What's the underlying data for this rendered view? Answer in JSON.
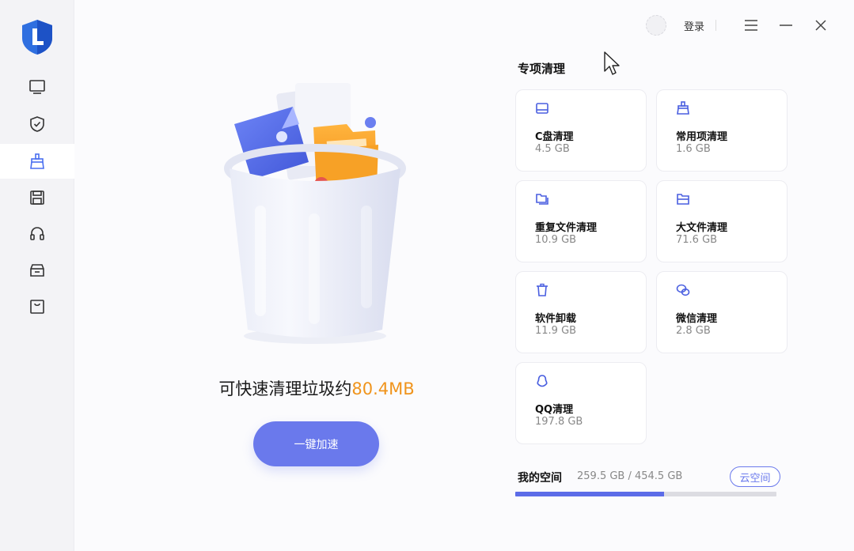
{
  "sidebar": {
    "items": [
      {
        "id": "monitor",
        "icon": "monitor-icon"
      },
      {
        "id": "shield",
        "icon": "shield-check-icon"
      },
      {
        "id": "clean",
        "icon": "broom-icon",
        "active": true
      },
      {
        "id": "disk",
        "icon": "floppy-disk-icon"
      },
      {
        "id": "support",
        "icon": "headset-icon"
      },
      {
        "id": "box",
        "icon": "archive-box-icon"
      },
      {
        "id": "bag",
        "icon": "shopping-bag-icon"
      }
    ]
  },
  "titlebar": {
    "login_label": "登录"
  },
  "center": {
    "headline_prefix": "可快速清理垃圾约",
    "headline_amount": "80.4MB",
    "button_label": "一键加速"
  },
  "panel": {
    "title": "专项清理",
    "cards": [
      {
        "name": "C盘清理",
        "size": "4.5 GB",
        "icon": "drive-icon"
      },
      {
        "name": "常用项清理",
        "size": "1.6 GB",
        "icon": "broom-icon"
      },
      {
        "name": "重复文件清理",
        "size": "10.9 GB",
        "icon": "duplicate-folder-icon"
      },
      {
        "name": "大文件清理",
        "size": "71.6 GB",
        "icon": "large-file-icon"
      },
      {
        "name": "软件卸载",
        "size": "11.9 GB",
        "icon": "trash-icon"
      },
      {
        "name": "微信清理",
        "size": "2.8 GB",
        "icon": "wechat-icon"
      },
      {
        "name": "QQ清理",
        "size": "197.8 GB",
        "icon": "qq-icon"
      }
    ]
  },
  "space": {
    "label": "我的空间",
    "value": "259.5 GB / 454.5 GB",
    "used_fraction": 0.571,
    "cloud_button": "云空间"
  },
  "colors": {
    "accent": "#6a79ec",
    "amount": "#f0941c",
    "progress": "#5c6ce8"
  }
}
